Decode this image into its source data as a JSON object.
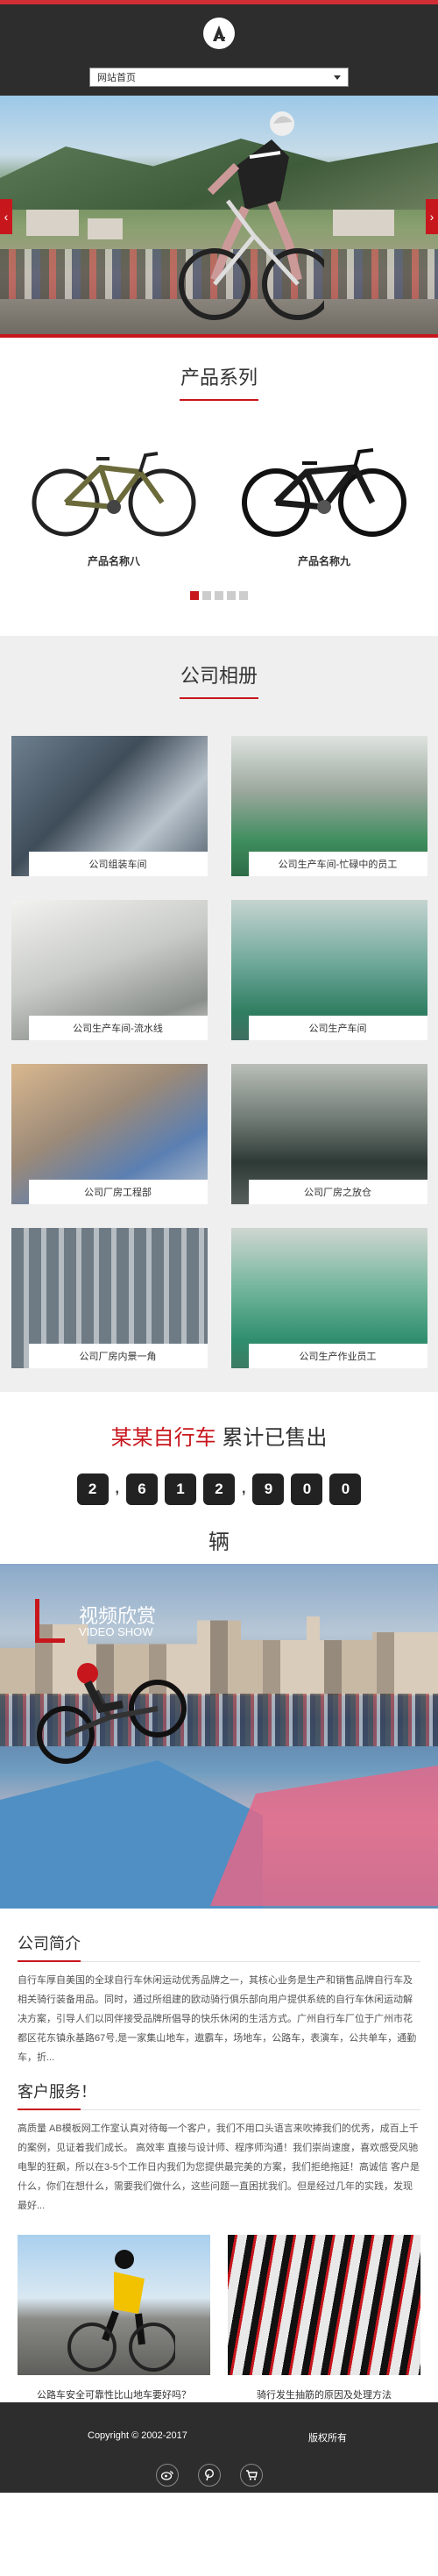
{
  "header": {
    "nav_select": "网站首页"
  },
  "hero": {
    "prev_arrow": "‹",
    "next_arrow": "›"
  },
  "products": {
    "title": "产品系列",
    "items": [
      {
        "name": "产品名称八"
      },
      {
        "name": "产品名称九"
      }
    ],
    "dots_count": 5,
    "active_dot": 0
  },
  "album": {
    "title": "公司相册",
    "items": [
      {
        "caption": "公司组装车间"
      },
      {
        "caption": "公司生产车间-忙碌中的员工"
      },
      {
        "caption": "公司生产车间-流水线"
      },
      {
        "caption": "公司生产车间"
      },
      {
        "caption": "公司厂房工程部"
      },
      {
        "caption": "公司厂房之放仓"
      },
      {
        "caption": "公司厂房内景一角"
      },
      {
        "caption": "公司生产作业员工"
      }
    ]
  },
  "counter": {
    "brand": "某某自行车",
    "text": " 累计已售出",
    "digits": [
      "2",
      "6",
      "1",
      "2",
      "9",
      "0",
      "0"
    ],
    "unit": "辆"
  },
  "video": {
    "title": "视频欣赏",
    "subtitle": "VIDEO SHOW"
  },
  "intro": {
    "title": "公司简介",
    "text": "自行车厚自美国的全球自行车休闲运动优秀品牌之一，其核心业务是生产和销售品牌自行车及相关骑行装备用品。同时，通过所组建的欧动骑行俱乐部向用户提供系统的自行车休闲运动解决方案，引导人们以同伴接受品牌所倡导的快乐休闲的生活方式。广州自行车厂位于广州市花都区花东镇永基路67号,是一家集山地车，遨霸车，场地车，公路车，表演车，公共单车，通勤车，折...",
    "service_title": "客户服务！",
    "service_text": "高质量 AB模板网工作室认真对待每一个客户，我们不用口头语言来吹捧我们的优秀，成百上千的案例，见证着我们成长。 高效率 直接与设计师、程序师沟通！我们崇尚速度，喜欢感受风驰电掣的狂飙，所以在3-5个工作日内我们为您提供最完美的方案，我们拒绝拖延！高诚信 客户是什么，你们在想什么，需要我们做什么，这些问题一直困扰我们。但是经过几年的实践，发现最好...",
    "news": [
      {
        "caption": "公路车安全可靠性比山地车要好吗？"
      },
      {
        "caption": "骑行发生抽筋的原因及处理方法"
      }
    ],
    "dots_count": 3,
    "active_dot": 0
  },
  "footer": {
    "copyright": "Copyright © 2002-2017",
    "rights": "版权所有",
    "icons": [
      "weibo-icon",
      "pinterest-icon",
      "cart-icon"
    ]
  },
  "colors": {
    "accent": "#c8161d",
    "header_bg": "#2d2d2d",
    "album_bg": "#efefef"
  }
}
